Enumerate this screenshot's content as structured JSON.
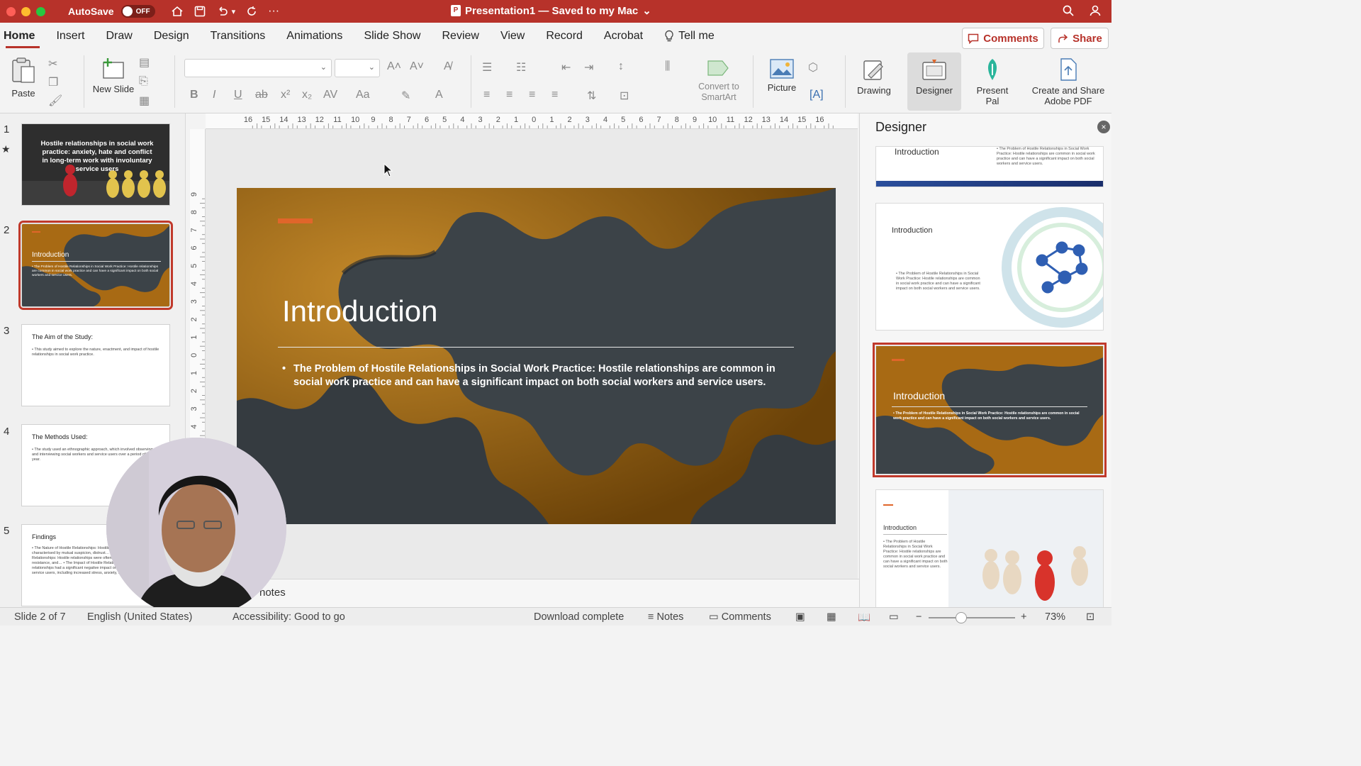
{
  "titlebar": {
    "autosave_label": "AutoSave",
    "autosave_state": "OFF",
    "doc_title": "Presentation1 — Saved to my Mac",
    "title_chevron": "⌄"
  },
  "tabs": [
    {
      "label": "Home",
      "active": true
    },
    {
      "label": "Insert"
    },
    {
      "label": "Draw"
    },
    {
      "label": "Design"
    },
    {
      "label": "Transitions"
    },
    {
      "label": "Animations"
    },
    {
      "label": "Slide Show"
    },
    {
      "label": "Review"
    },
    {
      "label": "View"
    },
    {
      "label": "Record"
    },
    {
      "label": "Acrobat"
    }
  ],
  "tell_me": "Tell me",
  "buttons": {
    "comments": "Comments",
    "share": "Share"
  },
  "ribbon": {
    "paste": "Paste",
    "new_slide": "New Slide",
    "convert_smartart": "Convert to SmartArt",
    "picture": "Picture",
    "drawing": "Drawing",
    "designer": "Designer",
    "present_pal": "Present Pal",
    "create_share_pdf": "Create and Share Adobe PDF"
  },
  "ruler": {
    "h_ticks": [
      "16",
      "15",
      "14",
      "13",
      "12",
      "11",
      "10",
      "9",
      "8",
      "7",
      "6",
      "5",
      "4",
      "3",
      "2",
      "1",
      "0",
      "1",
      "2",
      "3",
      "4",
      "5",
      "6",
      "7",
      "8",
      "9",
      "10",
      "11",
      "12",
      "13",
      "14",
      "15",
      "16"
    ],
    "v_ticks": [
      "9",
      "8",
      "7",
      "6",
      "5",
      "4",
      "3",
      "2",
      "1",
      "0",
      "1",
      "2",
      "3",
      "4",
      "5"
    ]
  },
  "slides": [
    {
      "num": "1",
      "title": "Hostile relationships in social work practice: anxiety, hate and conflict in long-term work with involuntary service users"
    },
    {
      "num": "2",
      "title": "Introduction",
      "body": "• The Problem of Hostile Relationships in Social Work Practice: Hostile relationships are common in social work practice and can have a significant impact on both social workers and service users."
    },
    {
      "num": "3",
      "title": "The Aim of the Study:",
      "body": "• This study aimed to explore the nature, enactment, and impact of hostile relationships in social work practice."
    },
    {
      "num": "4",
      "title": "The Methods Used:",
      "body": "• The study used an ethnographic approach, which involved observing and interviewing social workers and service users over a period of one year."
    },
    {
      "num": "5",
      "title": "Findings",
      "body": "• The Nature of Hostile Relationships: Hostile relationships were characterised by mutual suspicion, distrust… • The Enactment of Hostile Relationships: Hostile relationships were often enacted through conflict, resistance, and… • The Impact of Hostile Relationships: Hostile relationships had a significant negative impact on both social workers and service users, including increased stress, anxiety, and burnout."
    }
  ],
  "main_slide": {
    "title": "Introduction",
    "bullet": "The Problem of Hostile Relationships in Social Work Practice: Hostile relationships are common in social work practice and can have a significant impact on both social workers and service users."
  },
  "notes_placeholder": "notes",
  "designer": {
    "title": "Designer",
    "close_icon": "×",
    "cards": [
      {
        "title": "Introduction",
        "body": "• The Problem of Hostile Relationships in Social Work Practice: Hostile relationships are common in social work practice and can have a significant impact on both social workers and service users."
      },
      {
        "title": "Introduction",
        "body": "• The Problem of Hostile Relationships in Social Work Practice: Hostile relationships are common in social work practice and can have a significant impact on both social workers and service users."
      },
      {
        "title": "Introduction",
        "body": "• The Problem of Hostile Relationships in Social Work Practice: Hostile relationships are common in social work practice and can have a significant impact on both social workers and service users."
      },
      {
        "title": "Introduction",
        "body": "• The Problem of Hostile Relationships in Social Work Practice: Hostile relationships are common in social work practice and can have a significant impact on both social workers and service users."
      }
    ]
  },
  "statusbar": {
    "slide_pos": "Slide 2 of 7",
    "language": "English (United States)",
    "accessibility": "Accessibility: Good to go",
    "download": "Download complete",
    "notes": "Notes",
    "comments": "Comments",
    "zoom": "73%"
  },
  "colors": {
    "accent": "#b7322a",
    "slide_accent": "#e0662a",
    "slide_bg": "#a86a14",
    "puzzle": "#3c4348"
  }
}
